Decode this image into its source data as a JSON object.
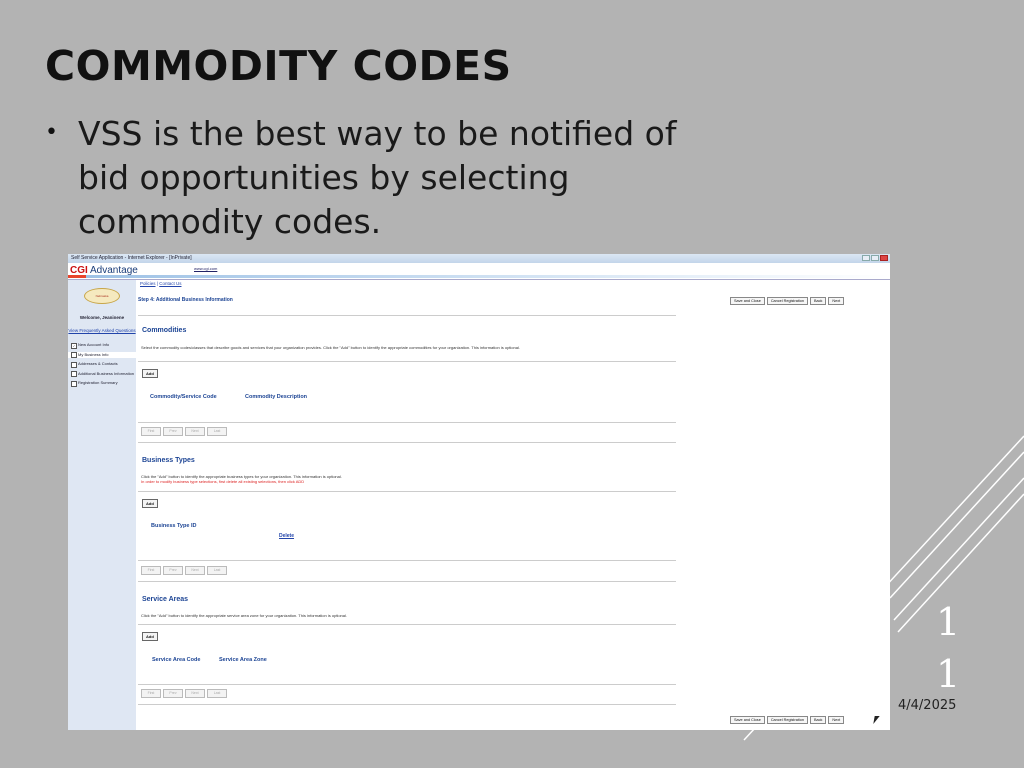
{
  "slide": {
    "title": "COMMODITY CODES",
    "bullet": "VSS is the best way to be notified of bid opportunities by selecting commodity codes.",
    "date": "4/4/2025",
    "page_number_digits": [
      "1",
      "1"
    ]
  },
  "window": {
    "title": "Self Service Application - Internet Explorer - [InPrivate]",
    "app_name": "Advantage",
    "app_brand": "CGI",
    "url": "www.cgi.com"
  },
  "sidebar": {
    "logo_text": "Nebraska",
    "welcome": "Welcome, Jeaninene",
    "faq_link": "View Frequently Asked Questions",
    "items": [
      {
        "label": "New Account Info",
        "checked": true
      },
      {
        "label": "My Business Info",
        "checked": false
      },
      {
        "label": "Addresses & Contacts",
        "checked": false
      },
      {
        "label": "Additional Business Information",
        "checked": false
      },
      {
        "label": "Registration Summary",
        "checked": false
      }
    ]
  },
  "main": {
    "links": {
      "policies": "Policies",
      "separator": "|",
      "contact": "Contact Us"
    },
    "step_title": "Step 4: Additional Business Information",
    "buttons": {
      "save_close": "Save and Close",
      "cancel": "Cancel Registration",
      "back": "Back",
      "next": "Next"
    },
    "pager": {
      "first": "First",
      "prev": "Prev",
      "next": "Next",
      "last": "Last"
    },
    "commodities": {
      "title": "Commodities",
      "desc": "Select the commodity codes/classes that describe goods and services that your organization provides. Click the \"Add\" button to identify the appropriate commodities for your organization. This information is optional.",
      "add": "Add",
      "col1": "Commodity/Service Code",
      "col2": "Commodity Description"
    },
    "business_types": {
      "title": "Business Types",
      "desc": "Click the \"Add\" button to identify the appropriate business types for your organization. This information is optional.",
      "warn": "In order to modify business type selections, first delete all existing selections, then click ADD",
      "add": "Add",
      "col1": "Business Type ID",
      "delete": "Delete"
    },
    "service_areas": {
      "title": "Service Areas",
      "desc": "Click the \"Add\" button to identify the appropriate service area zone for your organization. This information is optional.",
      "add": "Add",
      "col1": "Service Area Code",
      "col2": "Service Area Zone"
    }
  },
  "colors": {
    "background": "#b3b3b3",
    "heading_blue": "#1c4494",
    "link_blue": "#2244aa",
    "warn_red": "#d22222"
  }
}
